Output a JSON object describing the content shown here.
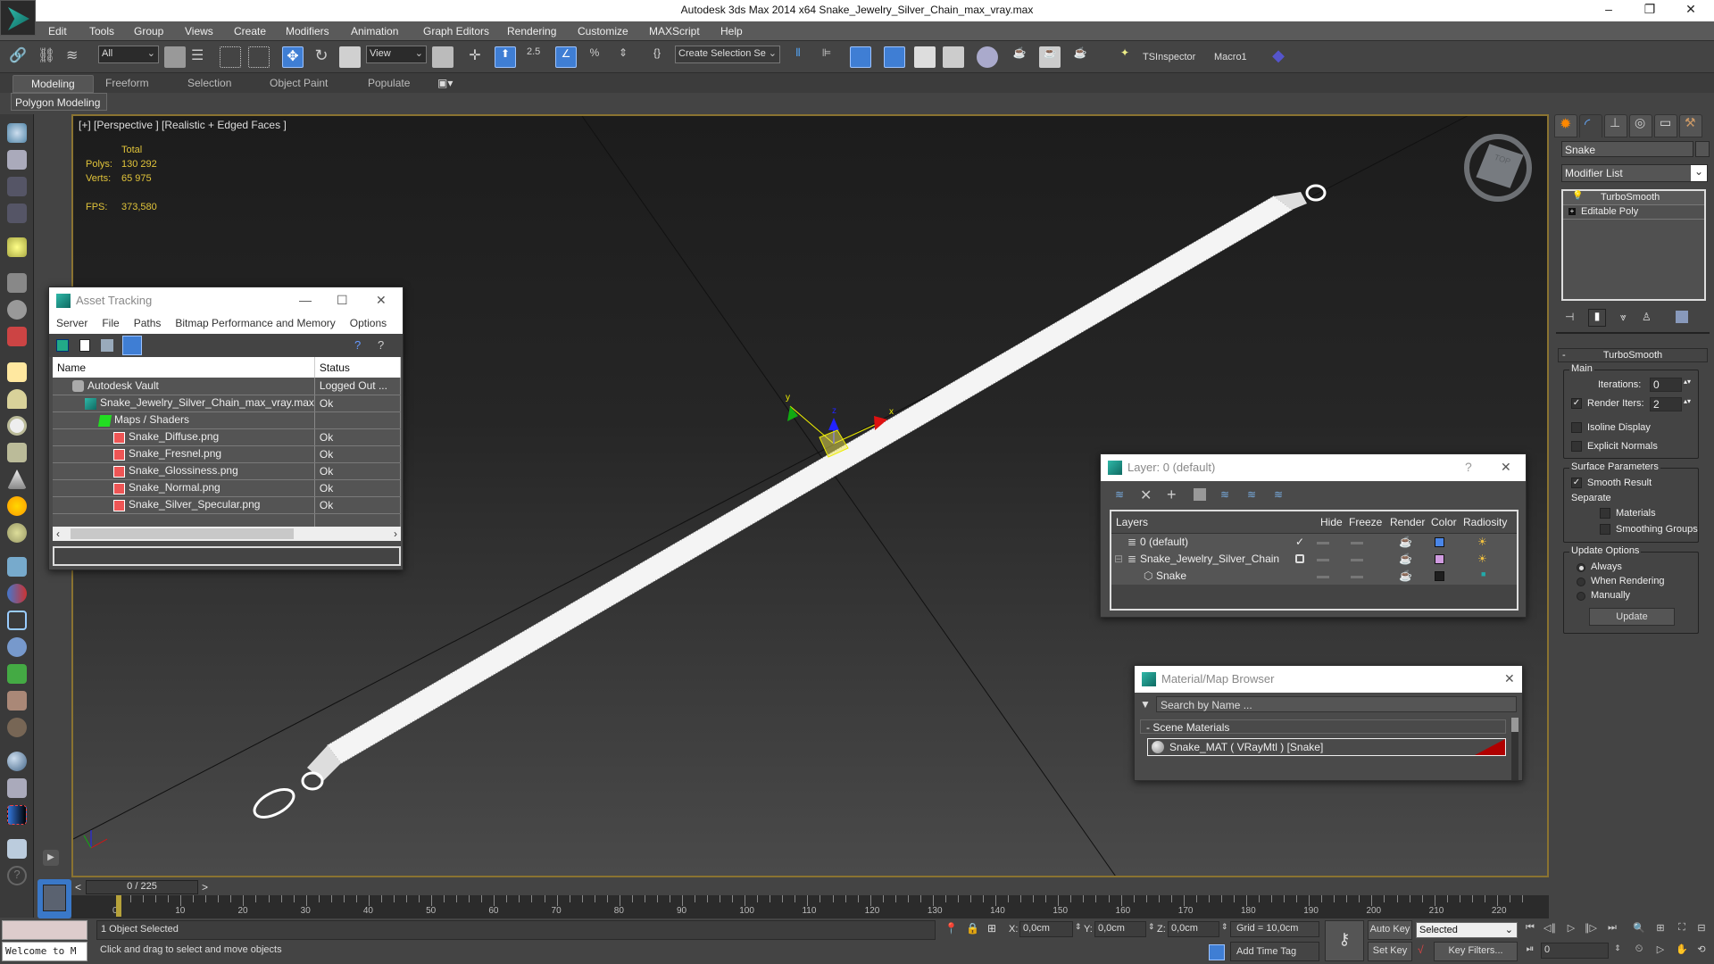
{
  "window": {
    "title": "Autodesk 3ds Max  2014 x64     Snake_Jewelry_Silver_Chain_max_vray.max",
    "minimize": "–",
    "restore": "❐",
    "close": "✕"
  },
  "menu": [
    "Edit",
    "Tools",
    "Group",
    "Views",
    "Create",
    "Modifiers",
    "Animation",
    "Graph Editors",
    "Rendering",
    "Customize",
    "MAXScript",
    "Help"
  ],
  "toolbar": {
    "selection_filter": "All",
    "ref_coord": "View",
    "snap_value": "2.5",
    "named_selection": "Create Selection Se",
    "tsinspector": "TSInspector",
    "macro": "Macro1"
  },
  "ribbon": {
    "tabs": [
      "Modeling",
      "Freeform",
      "Selection",
      "Object Paint",
      "Populate"
    ],
    "active": "Modeling",
    "panel": "Polygon Modeling"
  },
  "viewport": {
    "label": "[+] [Perspective ] [Realistic + Edged Faces ]",
    "stats": {
      "header": "Total",
      "polys_label": "Polys:",
      "polys": "130 292",
      "verts_label": "Verts:",
      "verts": "65 975",
      "fps_label": "FPS:",
      "fps": "373,580"
    },
    "viewcube_label": "TOP",
    "gizmo": {
      "x": "x",
      "y": "y",
      "z": "z"
    }
  },
  "asset_tracking": {
    "title": "Asset Tracking",
    "menu": [
      "Server",
      "File",
      "Paths",
      "Bitmap Performance and Memory",
      "Options"
    ],
    "columns": [
      "Name",
      "Status"
    ],
    "rows": [
      {
        "name": "Autodesk Vault",
        "status": "Logged Out ...",
        "icon": "vault-icon",
        "indent": 1
      },
      {
        "name": "Snake_Jewelry_Silver_Chain_max_vray.max",
        "status": "Ok",
        "icon": "max-file-icon",
        "indent": 2
      },
      {
        "name": "Maps / Shaders",
        "status": "",
        "icon": "maps-icon",
        "indent": 3
      },
      {
        "name": "Snake_Diffuse.png",
        "status": "Ok",
        "icon": "bitmap-icon",
        "indent": 4
      },
      {
        "name": "Snake_Fresnel.png",
        "status": "Ok",
        "icon": "bitmap-icon",
        "indent": 4
      },
      {
        "name": "Snake_Glossiness.png",
        "status": "Ok",
        "icon": "bitmap-icon",
        "indent": 4
      },
      {
        "name": "Snake_Normal.png",
        "status": "Ok",
        "icon": "bitmap-icon",
        "indent": 4
      },
      {
        "name": "Snake_Silver_Specular.png",
        "status": "Ok",
        "icon": "bitmap-icon",
        "indent": 4
      }
    ]
  },
  "layer_dialog": {
    "title": "Layer: 0 (default)",
    "help": "?",
    "columns": [
      "Layers",
      "",
      "Hide",
      "Freeze",
      "Render",
      "Color",
      "Radiosity"
    ],
    "rows": [
      {
        "name": "0 (default)",
        "current": "✓",
        "color": "#4a86e8"
      },
      {
        "name": "Snake_Jewelry_Silver_Chain",
        "current": "",
        "color": "#d09be0",
        "expander": "⊟"
      },
      {
        "name": "Snake",
        "current": "",
        "color": "#1e1e1e"
      }
    ]
  },
  "material_browser": {
    "title": "Material/Map Browser",
    "search_placeholder": "Search by Name ...",
    "section": "- Scene Materials",
    "material": "Snake_MAT  ( VRayMtl )  [Snake]",
    "accent": "#b00000"
  },
  "command_panel": {
    "object_name": "Snake",
    "modifier_list": "Modifier List",
    "stack": [
      "TurboSmooth",
      "Editable Poly"
    ],
    "turbosmooth": {
      "title": "TurboSmooth",
      "main": "Main",
      "iterations_label": "Iterations:",
      "iterations": "0",
      "render_iters_label": "Render Iters:",
      "render_iters": "2",
      "render_iters_checked": true,
      "isoline": "Isoline Display",
      "explicit_normals": "Explicit Normals",
      "surface_params": "Surface Parameters",
      "smooth_result": "Smooth Result",
      "separate": "Separate",
      "materials": "Materials",
      "smoothing_groups": "Smoothing Groups",
      "update_options": "Update Options",
      "always": "Always",
      "when_rendering": "When Rendering",
      "manually": "Manually",
      "update": "Update"
    }
  },
  "timeline": {
    "frame_display": "0 / 225",
    "ticks": [
      "0",
      "10",
      "20",
      "30",
      "40",
      "50",
      "60",
      "70",
      "80",
      "90",
      "100",
      "110",
      "120",
      "130",
      "140",
      "150",
      "160",
      "170",
      "180",
      "190",
      "200",
      "210",
      "220"
    ]
  },
  "status": {
    "maxscript_listener": "",
    "welcome": "Welcome to M",
    "selection": "1 Object Selected",
    "prompt": "Click and drag to select and move objects",
    "x_label": "X:",
    "x": "0,0cm",
    "y_label": "Y:",
    "y": "0,0cm",
    "z_label": "Z:",
    "z": "0,0cm",
    "grid": "Grid = 10,0cm",
    "add_time_tag": "Add Time Tag",
    "auto_key": "Auto Key",
    "set_key": "Set Key",
    "key_mode": "Selected",
    "key_filters": "Key Filters...",
    "current_frame": "0"
  }
}
